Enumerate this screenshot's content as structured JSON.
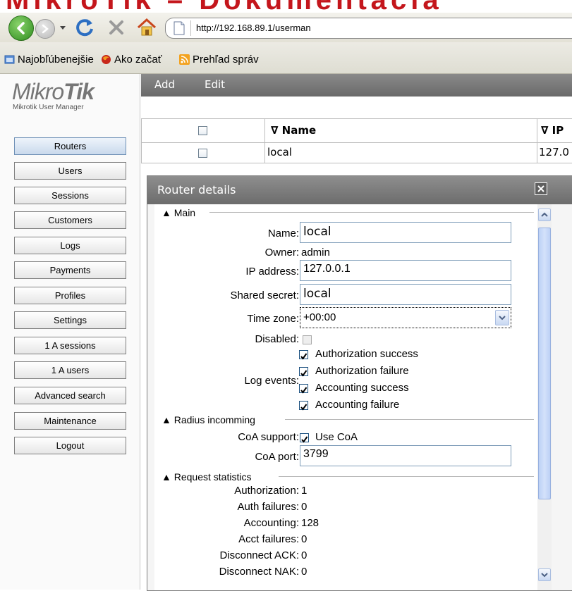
{
  "banner": {
    "text": "MikroTik – Dokumentácia"
  },
  "browser": {
    "url": "http://192.168.89.1/userman",
    "bookmarks": [
      "Najobľúbenejšie",
      "Ako začať",
      "Prehľad správ"
    ]
  },
  "logo": {
    "brand_light": "Mikro",
    "brand_bold": "Tik",
    "subtitle": "Mikrotik User Manager"
  },
  "sidebar": {
    "items": [
      {
        "label": "Routers"
      },
      {
        "label": "Users"
      },
      {
        "label": "Sessions"
      },
      {
        "label": "Customers"
      },
      {
        "label": "Logs"
      },
      {
        "label": "Payments"
      },
      {
        "label": "Profiles"
      },
      {
        "label": "Settings"
      },
      {
        "label": "1 A sessions"
      },
      {
        "label": "1 A users"
      },
      {
        "label": "Advanced search"
      },
      {
        "label": "Maintenance"
      },
      {
        "label": "Logout"
      }
    ],
    "active": "Routers"
  },
  "menubar": {
    "add": "Add",
    "edit": "Edit"
  },
  "table": {
    "headers": {
      "name": "∇ Name",
      "ip": "∇ IP"
    },
    "rows": [
      {
        "name": "local",
        "ip": "127.0"
      }
    ]
  },
  "dialog": {
    "title": "Router details",
    "main": {
      "section": "▲ Main",
      "name_label": "Name:",
      "name_value": "local",
      "owner_label": "Owner:",
      "owner_value": "admin",
      "ip_label": "IP address:",
      "ip_value": "127.0.0.1",
      "secret_label": "Shared secret:",
      "secret_value": "local",
      "tz_label": "Time zone:",
      "tz_value": "+00:00",
      "disabled_label": "Disabled:",
      "log_events_label": "Log events:",
      "log_events": [
        "Authorization success",
        "Authorization failure",
        "Accounting success",
        "Accounting failure"
      ]
    },
    "radius": {
      "section": "▲ Radius incomming",
      "coa_support_label": "CoA support:",
      "coa_support_value": "Use CoA",
      "coa_port_label": "CoA port:",
      "coa_port_value": "3799"
    },
    "stats": {
      "section": "▲ Request statistics",
      "rows": [
        {
          "label": "Authorization:",
          "value": "1"
        },
        {
          "label": "Auth failures:",
          "value": "0"
        },
        {
          "label": "Accounting:",
          "value": "128"
        },
        {
          "label": "Acct failures:",
          "value": "0"
        },
        {
          "label": "Disconnect ACK:",
          "value": "0"
        },
        {
          "label": "Disconnect NAK:",
          "value": "0"
        }
      ]
    }
  },
  "icons": {
    "back": "back-arrow-icon",
    "forward": "forward-arrow-icon",
    "reload": "reload-icon",
    "stop": "stop-icon",
    "home": "home-icon",
    "page": "page-icon",
    "close": "close-icon",
    "dropdown": "chevron-down-icon"
  },
  "colors": {
    "brand_red": "#c4161c",
    "title_bar": "#7a7a7a",
    "menubar": "#7a7a7a",
    "link_blue": "#1c5180"
  }
}
